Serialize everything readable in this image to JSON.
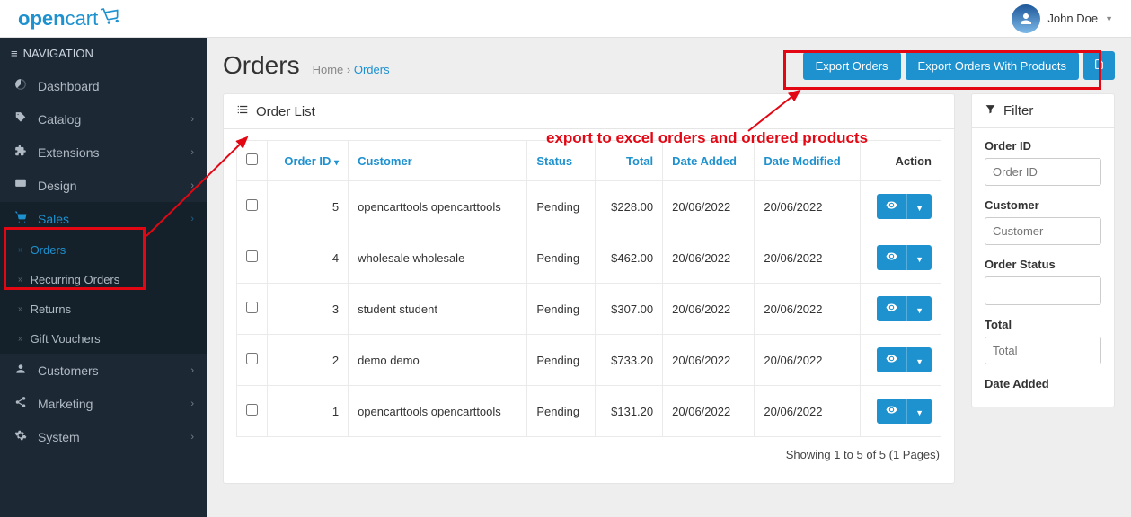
{
  "header": {
    "logo_a": "open",
    "logo_b": "cart",
    "user_name": "John Doe"
  },
  "sidebar": {
    "nav_label": "NAVIGATION",
    "items": [
      {
        "label": "Dashboard"
      },
      {
        "label": "Catalog"
      },
      {
        "label": "Extensions"
      },
      {
        "label": "Design"
      },
      {
        "label": "Sales"
      },
      {
        "label": "Customers"
      },
      {
        "label": "Marketing"
      },
      {
        "label": "System"
      }
    ],
    "sales_sub": [
      {
        "label": "Orders"
      },
      {
        "label": "Recurring Orders"
      },
      {
        "label": "Returns"
      },
      {
        "label": "Gift Vouchers"
      }
    ]
  },
  "page": {
    "title": "Orders",
    "bc_home": "Home",
    "bc_current": "Orders",
    "btn_export": "Export Orders",
    "btn_export_products": "Export Orders With Products"
  },
  "list": {
    "heading": "Order List",
    "cols": {
      "order_id": "Order ID",
      "customer": "Customer",
      "status": "Status",
      "total": "Total",
      "date_added": "Date Added",
      "date_modified": "Date Modified",
      "action": "Action"
    },
    "rows": [
      {
        "id": "5",
        "customer": "opencarttools opencarttools",
        "status": "Pending",
        "total": "$228.00",
        "added": "20/06/2022",
        "modified": "20/06/2022"
      },
      {
        "id": "4",
        "customer": "wholesale wholesale",
        "status": "Pending",
        "total": "$462.00",
        "added": "20/06/2022",
        "modified": "20/06/2022"
      },
      {
        "id": "3",
        "customer": "student student",
        "status": "Pending",
        "total": "$307.00",
        "added": "20/06/2022",
        "modified": "20/06/2022"
      },
      {
        "id": "2",
        "customer": "demo demo",
        "status": "Pending",
        "total": "$733.20",
        "added": "20/06/2022",
        "modified": "20/06/2022"
      },
      {
        "id": "1",
        "customer": "opencarttools opencarttools",
        "status": "Pending",
        "total": "$131.20",
        "added": "20/06/2022",
        "modified": "20/06/2022"
      }
    ],
    "paging": "Showing 1 to 5 of 5 (1 Pages)"
  },
  "filter": {
    "heading": "Filter",
    "order_id_label": "Order ID",
    "order_id_ph": "Order ID",
    "customer_label": "Customer",
    "customer_ph": "Customer",
    "status_label": "Order Status",
    "total_label": "Total",
    "total_ph": "Total",
    "date_added_label": "Date Added"
  },
  "annotation": {
    "text": "export to excel orders and ordered products"
  }
}
